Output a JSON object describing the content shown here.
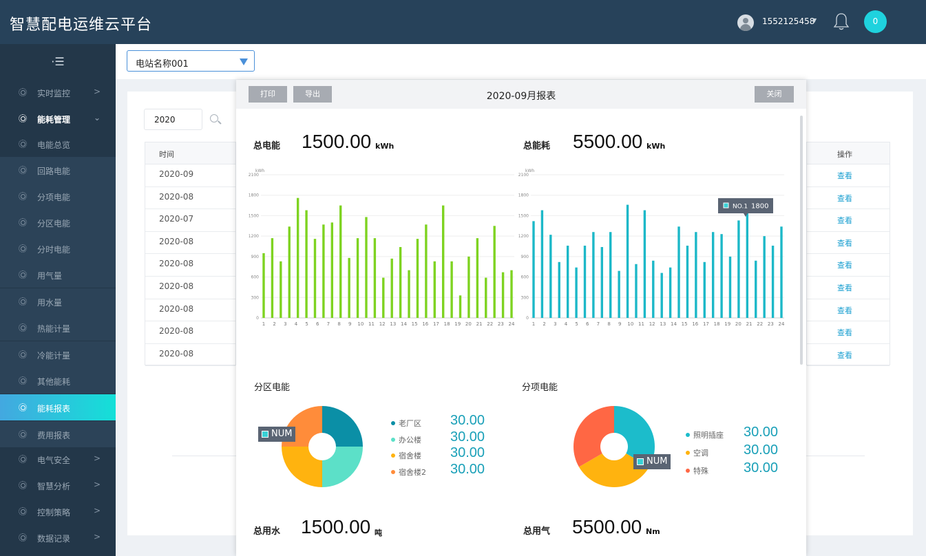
{
  "app": {
    "title": "智慧配电运维云平台"
  },
  "header": {
    "user": "1552125458",
    "notifications": "0"
  },
  "sidebar": {
    "collapse_icon": "menu-collapse-icon",
    "items": [
      {
        "label": "实时监控",
        "arrow": ">"
      },
      {
        "label": "能耗管理",
        "arrow": "⌄"
      },
      {
        "label": "电能总览",
        "arrow": ""
      },
      {
        "label": "回路电能",
        "arrow": ""
      },
      {
        "label": "分项电能",
        "arrow": ""
      },
      {
        "label": "分区电能",
        "arrow": ""
      },
      {
        "label": "分时电能",
        "arrow": ""
      },
      {
        "label": "用气量",
        "arrow": ""
      },
      {
        "label": "用水量",
        "arrow": ""
      },
      {
        "label": "热能计量",
        "arrow": ""
      },
      {
        "label": "冷能计量",
        "arrow": ""
      },
      {
        "label": "其他能耗",
        "arrow": ""
      },
      {
        "label": "能耗报表",
        "arrow": ""
      },
      {
        "label": "费用报表",
        "arrow": ""
      },
      {
        "label": "电气安全",
        "arrow": ">"
      },
      {
        "label": "智慧分析",
        "arrow": ">"
      },
      {
        "label": "控制策略",
        "arrow": ">"
      },
      {
        "label": "数据记录",
        "arrow": ">"
      }
    ]
  },
  "toolbar": {
    "station": "电站名称001"
  },
  "filter": {
    "year": "2020"
  },
  "table": {
    "col_time": "时间",
    "col_op": "操作",
    "rows": [
      {
        "time": "2020-09",
        "op": "查看"
      },
      {
        "time": "2020-08",
        "op": "查看"
      },
      {
        "time": "2020-07",
        "op": "查看"
      },
      {
        "time": "2020-08",
        "op": "查看"
      },
      {
        "time": "2020-08",
        "op": "查看"
      },
      {
        "time": "2020-08",
        "op": "查看"
      },
      {
        "time": "2020-08",
        "op": "查看"
      },
      {
        "time": "2020-08",
        "op": "查看"
      },
      {
        "time": "2020-08",
        "op": "查看"
      }
    ]
  },
  "modal": {
    "title": "2020-09月报表",
    "print": "打印",
    "export": "导出",
    "close": "关闭",
    "stats": {
      "elec_label": "总电能",
      "elec_value": "1500.00",
      "elec_unit": "kWh",
      "energy_label": "总能耗",
      "energy_value": "5500.00",
      "energy_unit": "kWh",
      "water_label": "总用水",
      "water_value": "1500.00",
      "water_unit": "吨",
      "gas_label": "总用气",
      "gas_value": "5500.00",
      "gas_unit": "Nm"
    },
    "zone_title": "分区电能",
    "item_title": "分项电能",
    "zone_tag": "NUM",
    "item_tag": "NUM"
  },
  "chart_data": [
    {
      "type": "bar",
      "title": "",
      "ylabel": "kWh",
      "ylim": [
        0,
        2100
      ],
      "yticks": [
        0,
        300,
        600,
        900,
        1200,
        1500,
        1800,
        2100
      ],
      "categories": [
        "1",
        "2",
        "3",
        "4",
        "5",
        "6",
        "7",
        "8",
        "9",
        "10",
        "11",
        "12",
        "13",
        "14",
        "15",
        "16",
        "17",
        "18",
        "19",
        "20",
        "21",
        "22",
        "23",
        "24"
      ],
      "series": [
        {
          "color": "#7ed321",
          "values": [
            950,
            1170,
            830,
            1340,
            1760,
            1580,
            1160,
            1370,
            1400,
            1650,
            880,
            1170,
            1480,
            1170,
            590,
            870,
            1040,
            700,
            1160,
            1370,
            830,
            1650,
            830,
            330,
            900,
            1170,
            590,
            1350,
            670,
            700
          ]
        }
      ],
      "grid": true
    },
    {
      "type": "bar",
      "title": "",
      "ylabel": "kWh",
      "ylim": [
        0,
        2100
      ],
      "yticks": [
        0,
        300,
        600,
        900,
        1200,
        1500,
        1800,
        2100
      ],
      "categories": [
        "1",
        "2",
        "3",
        "4",
        "5",
        "6",
        "7",
        "8",
        "9",
        "10",
        "11",
        "12",
        "13",
        "14",
        "15",
        "16",
        "17",
        "18",
        "19",
        "20",
        "21",
        "22",
        "23",
        "24"
      ],
      "series": [
        {
          "color": "#1cb8c8",
          "values": [
            1420,
            1580,
            1220,
            820,
            1060,
            740,
            1060,
            1260,
            1040,
            1260,
            690,
            1660,
            790,
            1580,
            840,
            660,
            740,
            1340,
            1060,
            1260,
            820,
            1260,
            1230,
            900,
            1430,
            1580,
            840,
            1200,
            1060,
            1340
          ]
        }
      ],
      "tooltip": {
        "label": "NO.1",
        "value": "1800"
      },
      "grid": true
    },
    {
      "type": "pie",
      "title": "分区电能",
      "labels": [
        "老厂区",
        "办公楼",
        "宿舍楼",
        "宿舍楼2"
      ],
      "values": [
        30.0,
        30.0,
        30.0,
        30.0
      ],
      "colors": [
        "#0b8fa6",
        "#5ce0c8",
        "#ffb30f",
        "#ff8c3a"
      ]
    },
    {
      "type": "pie",
      "title": "分项电能",
      "labels": [
        "照明插座",
        "空调",
        "特殊"
      ],
      "values": [
        30.0,
        30.0,
        30.0
      ],
      "colors": [
        "#1cbccb",
        "#ffb30f",
        "#ff6744"
      ]
    }
  ]
}
